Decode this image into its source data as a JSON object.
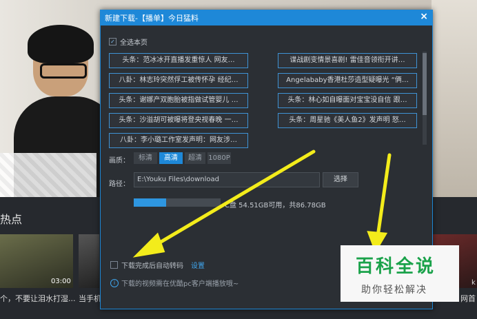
{
  "background": {
    "section_title": "热点",
    "thumb1_duration": "03:00",
    "caption1": "个，不要让泪水打湿...",
    "caption2": "当手机",
    "caption3": "网首",
    "caption4": "k"
  },
  "dialog": {
    "title": "新建下载-【播单】今日猛料",
    "close_label": "×",
    "select_all": "全选本页",
    "select_all_mark": "✓",
    "left_items": [
      "头条：范冰冰开直播发重惊人  网友…",
      "八卦：林志玲突然俘工被传怀孕 经纪…",
      "头条：谢娜产双胞胎被指做试管婴儿 …",
      "头条：沙溢胡可被曝将登央视春晚 一…",
      "八卦：李小璐工作室发声明：网友涉…"
    ],
    "right_items": [
      "谍战剧变情景喜剧! 雷佳音领衔开讲…",
      "Angelababy香港杜莎造型疑曝光 “俩…",
      "头条：林心如自曝面对宝宝没自信 跟…",
      "头条：周星驰《美人鱼2》发声明  怒…"
    ],
    "quality_label": "画质：",
    "quality_options": [
      "标清",
      "高清",
      "超清",
      "1080P"
    ],
    "quality_selected": "高清",
    "path_label": "路径：",
    "path_value": "E:\\Youku Files\\download",
    "browse_label": "选择",
    "disk_used_fraction": 0.37,
    "disk_text": "C盘 54.51GB可用，共86.78GB",
    "auto_transcode": "下载完成后自动转码",
    "settings_link": "设置",
    "notice": "下载的视频需在优酷pc客户端播放哦~",
    "info_icon": "i"
  },
  "watermark": {
    "big": "百科全说",
    "small": "助你轻松解决"
  },
  "colors": {
    "accent": "#1e88d8",
    "arrow": "#f3ec1b",
    "watermark_green": "#1aa24a"
  }
}
